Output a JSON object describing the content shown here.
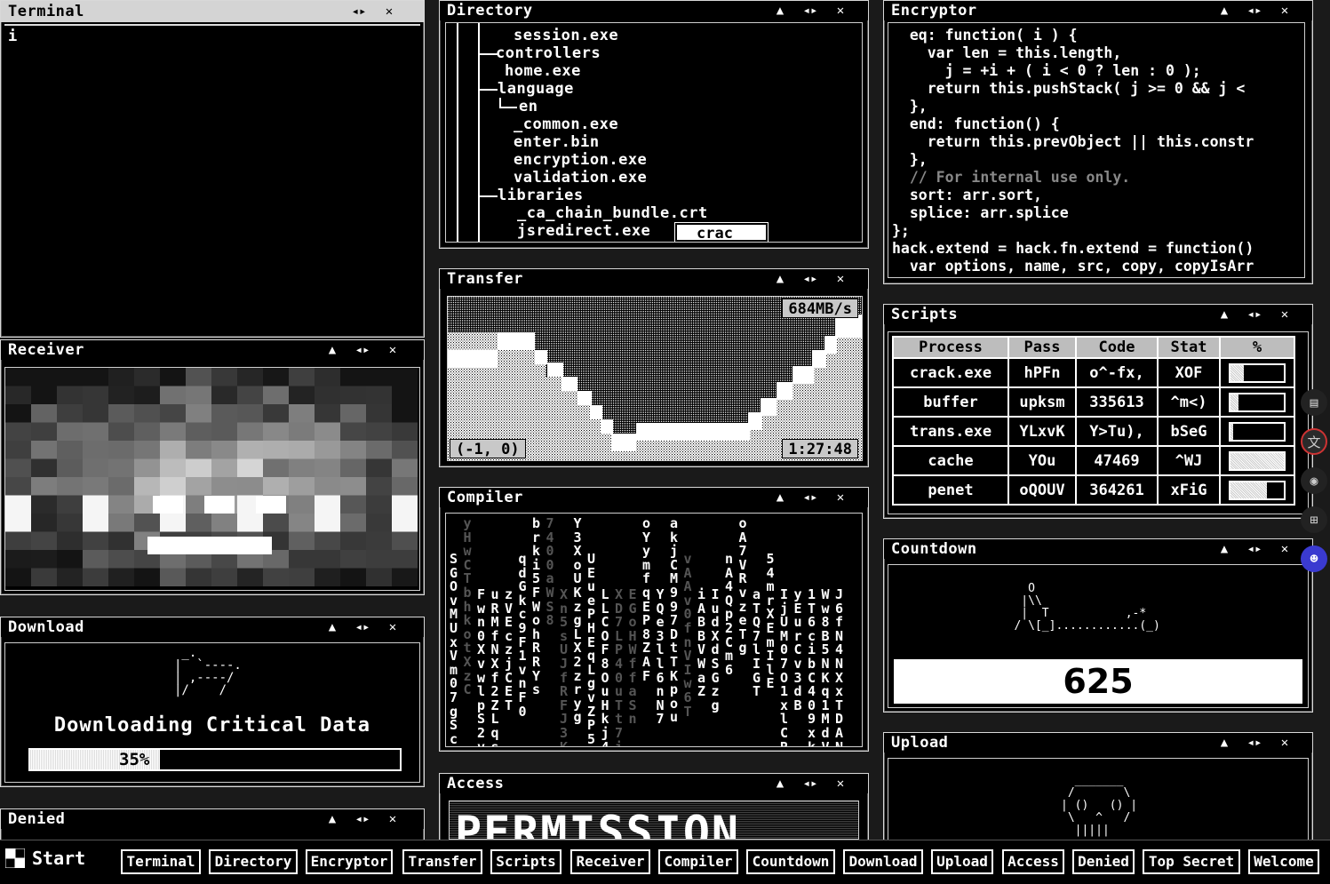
{
  "windows": {
    "terminal": {
      "title": "Terminal",
      "prompt": "i"
    },
    "directory": {
      "title": "Directory",
      "lines": [
        "session.exe",
        "controllers",
        "home.exe",
        "language",
        "en",
        "_common.exe",
        "enter.bin",
        "encryption.exe",
        "validation.exe",
        "libraries",
        "_ca_chain_bundle.crt",
        "jsredirect.exe"
      ],
      "rename_value": "crac"
    },
    "encryptor": {
      "title": "Encryptor",
      "code": [
        "  eq: function( i ) {",
        "    var len = this.length,",
        "      j = +i + ( i < 0 ? len : 0 );",
        "    return this.pushStack( j >= 0 && j <",
        "  },",
        "  end: function() {",
        "    return this.prevObject || this.constr",
        "  },",
        "  // For internal use only.",
        "  sort: arr.sort,",
        "  splice: arr.splice",
        "};",
        "hack.extend = hack.fn.extend = function()",
        "  var options, name, src, copy, copyIsArr"
      ]
    },
    "transfer": {
      "title": "Transfer",
      "speed": "684MB/s",
      "coords": "(-1, 0)",
      "time": "1:27:48"
    },
    "scripts": {
      "title": "Scripts",
      "headers": [
        "Process",
        "Pass",
        "Code",
        "Stat",
        "%"
      ],
      "rows": [
        {
          "process": "crack.exe",
          "pass": "hPFn",
          "code": "o^-fx,",
          "stat": "XOF",
          "pct": 0.25
        },
        {
          "process": "buffer",
          "pass": "upksm",
          "code": "335613",
          "stat": "^m<)",
          "pct": 0.15
        },
        {
          "process": "trans.exe",
          "pass": "YLxvK",
          "code": "Y>Tu),",
          "stat": "bSeG",
          "pct": 0.05
        },
        {
          "process": "cache",
          "pass": "YOu",
          "code": "47469",
          "stat": "^WJ",
          "pct": 1.0
        },
        {
          "process": "penet",
          "pass": "oQOUV",
          "code": "364261",
          "stat": "xFiG",
          "pct": 0.68
        }
      ]
    },
    "countdown": {
      "title": "Countdown",
      "value": "625"
    },
    "receiver": {
      "title": "Receiver"
    },
    "compiler": {
      "title": "Compiler"
    },
    "download": {
      "title": "Download",
      "label": "Downloading Critical Data",
      "percent_label": "35%",
      "progress": 0.35
    },
    "upload": {
      "title": "Upload"
    },
    "access": {
      "title": "Access",
      "banner": "PERMISSION"
    },
    "denied": {
      "title": "Denied"
    }
  },
  "controls": {
    "maximize": "▲",
    "resize": "◂▸",
    "close": "✕"
  },
  "taskbar": {
    "start_label": "Start",
    "buttons": [
      "Terminal",
      "Directory",
      "Encryptor",
      "Transfer",
      "Scripts",
      "Receiver",
      "Compiler",
      "Countdown",
      "Download",
      "Upload",
      "Access",
      "Denied",
      "Top Secret",
      "Welcome"
    ]
  },
  "dock_icons": [
    "book-icon",
    "translate-icon",
    "pin-icon",
    "grid-icon",
    "assistant-icon"
  ]
}
